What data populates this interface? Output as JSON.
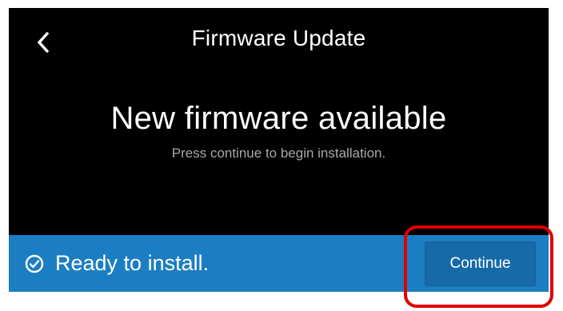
{
  "header": {
    "title": "Firmware Update",
    "back_icon": "chevron-left-icon"
  },
  "main": {
    "headline": "New firmware available",
    "subtext": "Press continue to begin installation."
  },
  "footer": {
    "status_icon": "check-circle-icon",
    "status_text": "Ready to install.",
    "continue_label": "Continue"
  },
  "colors": {
    "background": "#000000",
    "bar": "#1b7ec2",
    "button": "#176aa8",
    "annotation": "#e00000"
  }
}
